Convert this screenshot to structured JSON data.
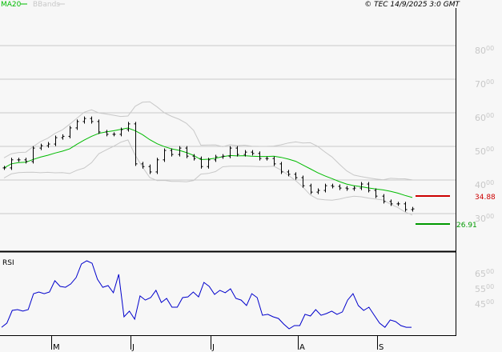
{
  "header": {
    "legend_ma": "MA20",
    "legend_bb": "BBands",
    "copyright": "© TEC 14/9/2025 3:0 GMT"
  },
  "colors": {
    "ma": "#00bb00",
    "bbands": "#c8c8c8",
    "bars": "#000000",
    "rsi": "#0000cc",
    "resistance": "#cc0000",
    "support": "#009900"
  },
  "chart_data": [
    {
      "type": "line",
      "title": "",
      "series_kind": "price bars with MA20 and Bollinger Bands",
      "ylim": [
        24,
        86
      ],
      "y_ticks": [
        {
          "int": "80",
          "dec": "00"
        },
        {
          "int": "70",
          "dec": "00"
        },
        {
          "int": "60",
          "dec": "00"
        },
        {
          "int": "50",
          "dec": "00"
        },
        {
          "int": "40",
          "dec": "00"
        },
        {
          "int": "30",
          "dec": "00"
        }
      ],
      "y_tick_values": [
        80,
        70,
        60,
        50,
        40,
        30
      ],
      "x_ticks": [
        "M",
        "J",
        "J",
        "A",
        "S"
      ],
      "close": [
        43.6,
        46,
        46,
        45.5,
        49.5,
        50.2,
        50.7,
        52.6,
        53,
        55.5,
        57.4,
        58.3,
        57.4,
        54.3,
        53.6,
        53.6,
        55,
        56.7,
        44.8,
        44,
        42.4,
        46,
        48.8,
        47.6,
        49.5,
        47.1,
        46.4,
        44,
        46,
        46.9,
        47.1,
        49.5,
        47.6,
        48.3,
        47.9,
        46.4,
        46.4,
        44.8,
        42.4,
        41.7,
        40.7,
        38.3,
        36.4,
        36.9,
        38.3,
        38.1,
        37.6,
        37.4,
        37.6,
        38.8,
        36.9,
        35.2,
        33.6,
        32.9,
        32.9,
        31.2,
        31.4
      ],
      "levels": {
        "resistance": {
          "value": 34.88,
          "label": "34.88"
        },
        "support": {
          "value": 26.91,
          "label": "26.91"
        }
      },
      "grid": true
    },
    {
      "type": "line",
      "title": "RSI",
      "y_ticks": [
        {
          "int": "65",
          "dec": "00"
        },
        {
          "int": "55",
          "dec": "00"
        },
        {
          "int": "45",
          "dec": "00"
        }
      ],
      "y_tick_values": [
        65,
        55,
        45
      ],
      "values": [
        29.7,
        32.4,
        40.8,
        41.3,
        40.3,
        41.3,
        51.8,
        52.9,
        51.8,
        52.9,
        60.3,
        56.6,
        56,
        58.2,
        62.4,
        71.3,
        73.4,
        71.8,
        61.3,
        56,
        57.1,
        52.4,
        64.5,
        36.6,
        40.3,
        35,
        50.3,
        47.6,
        49.2,
        54,
        46,
        48.7,
        42.9,
        42.9,
        49.2,
        49.7,
        52.9,
        49.7,
        59.2,
        56.6,
        51.3,
        54,
        52.4,
        55,
        48.7,
        47.6,
        44,
        51.8,
        49.2,
        37.6,
        38.2,
        36.6,
        35.5,
        31.8,
        28.7,
        30.8,
        30.8,
        38.2,
        37.1,
        41.3,
        37.6,
        38.7,
        40.3,
        38.2,
        39.8,
        47.6,
        51.8,
        44,
        40.8,
        42.9,
        37.6,
        32.4,
        29.7,
        34.5,
        33.4,
        30.8,
        29.7,
        29.7
      ]
    }
  ]
}
